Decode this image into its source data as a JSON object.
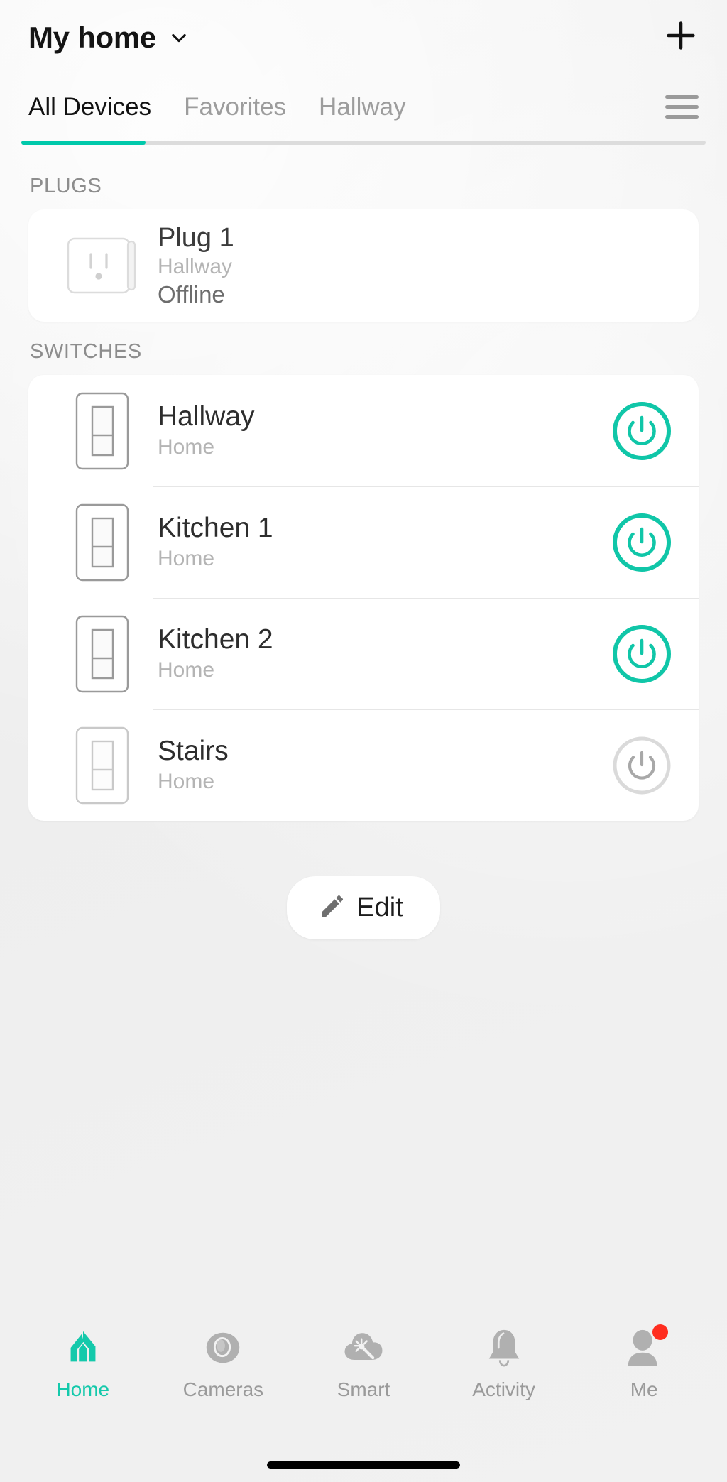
{
  "header": {
    "home_name": "My home",
    "chevron_icon": "chevron-down-icon",
    "add_icon": "plus-icon"
  },
  "tabs": {
    "items": [
      {
        "label": "All Devices",
        "active": true
      },
      {
        "label": "Favorites",
        "active": false
      },
      {
        "label": "Hallway",
        "active": false
      }
    ],
    "menu_icon": "hamburger-menu-icon",
    "active_color": "#00c9ab"
  },
  "sections": [
    {
      "label": "PLUGS",
      "devices": [
        {
          "name": "Plug 1",
          "room": "Hallway",
          "status": "Offline",
          "icon": "outlet-icon",
          "has_power_button": false
        }
      ]
    },
    {
      "label": "SWITCHES",
      "devices": [
        {
          "name": "Hallway",
          "room": "Home",
          "icon": "light-switch-icon",
          "has_power_button": true,
          "power_on": true
        },
        {
          "name": "Kitchen 1",
          "room": "Home",
          "icon": "light-switch-icon",
          "has_power_button": true,
          "power_on": true
        },
        {
          "name": "Kitchen 2",
          "room": "Home",
          "icon": "light-switch-icon",
          "has_power_button": true,
          "power_on": true
        },
        {
          "name": "Stairs",
          "room": "Home",
          "icon": "light-switch-icon",
          "has_power_button": true,
          "power_on": false
        }
      ]
    }
  ],
  "edit_button": {
    "label": "Edit",
    "icon": "pencil-icon"
  },
  "bottom_nav": {
    "items": [
      {
        "label": "Home",
        "icon": "house-icon",
        "active": true,
        "badge": false
      },
      {
        "label": "Cameras",
        "icon": "camera-lens-icon",
        "active": false,
        "badge": false
      },
      {
        "label": "Smart",
        "icon": "smart-cloud-icon",
        "active": false,
        "badge": false
      },
      {
        "label": "Activity",
        "icon": "bell-icon",
        "active": false,
        "badge": false
      },
      {
        "label": "Me",
        "icon": "person-icon",
        "active": false,
        "badge": true
      }
    ],
    "active_color": "#14c9ab",
    "badge_color": "#ff2d1f"
  }
}
